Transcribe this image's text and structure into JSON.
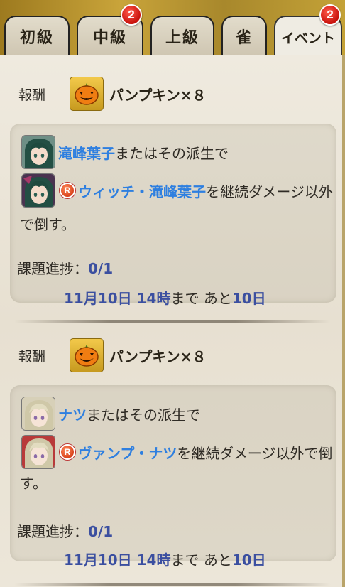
{
  "tabs": [
    {
      "label": "初級",
      "badge": ""
    },
    {
      "label": "中級",
      "badge": "2"
    },
    {
      "label": "上級",
      "badge": ""
    },
    {
      "label": "雀",
      "badge": ""
    },
    {
      "label": "イベント",
      "badge": "2",
      "active": true
    }
  ],
  "missions": [
    {
      "reward_label": "報酬",
      "reward_item": "パンプキン×８",
      "task_line1_name": "滝峰葉子",
      "task_line1_rest": "またはその派生で",
      "task_line2_badge": "R",
      "task_line2_name": "ウィッチ・滝峰葉子",
      "task_line2_rest": "を継続ダメージ以外",
      "task_line3": "で倒す。",
      "progress_label": "課題進捗：",
      "progress_value": "0/1",
      "deadline_date": "11月10日 14時",
      "deadline_mid": "まで あと",
      "deadline_days": "10日"
    },
    {
      "reward_label": "報酬",
      "reward_item": "パンプキン×８",
      "task_line1_name": "ナツ",
      "task_line1_rest": "またはその派生で",
      "task_line2_badge": "R",
      "task_line2_name": "ヴァンプ・ナツ",
      "task_line2_rest": "を継続ダメージ以外で倒",
      "task_line3": "す。",
      "progress_label": "課題進捗：",
      "progress_value": "0/1",
      "deadline_date": "11月10日 14時",
      "deadline_mid": "まで あと",
      "deadline_days": "10日"
    }
  ],
  "colors": {
    "accent_blue": "#2e7fe0",
    "progress_blue": "#3b4fa0",
    "badge_red": "#c8120c"
  },
  "icons": {
    "reward": "jack-o-lantern-icon",
    "rarity": "rare-r-icon"
  }
}
